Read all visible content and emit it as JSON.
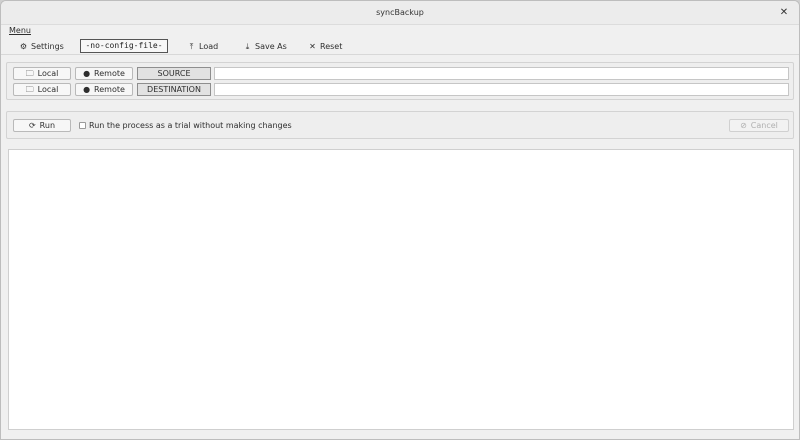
{
  "window": {
    "title": "syncBackup",
    "close_glyph": "✕"
  },
  "menubar": {
    "menu_label": "Menu"
  },
  "toolbar": {
    "settings": {
      "label": "Settings",
      "icon": "gear-icon",
      "glyph": "⚙"
    },
    "config_file": "-no-config-file-",
    "load": {
      "label": "Load",
      "icon": "upload-icon",
      "glyph": "⤒"
    },
    "save_as": {
      "label": "Save As",
      "icon": "download-icon",
      "glyph": "⤓"
    },
    "reset": {
      "label": "Reset",
      "icon": "close-icon",
      "glyph": "✕"
    }
  },
  "paths": {
    "source": {
      "local_label": "Local",
      "remote_label": "Remote",
      "tag": "SOURCE",
      "value": ""
    },
    "destination": {
      "local_label": "Local",
      "remote_label": "Remote",
      "tag": "DESTINATION",
      "value": ""
    },
    "icons": {
      "folder": "🗀",
      "globe": "●"
    }
  },
  "run": {
    "run_label": "Run",
    "run_glyph": "⟳",
    "trial_label": "Run the process as a trial without making changes",
    "trial_checked": false,
    "cancel_label": "Cancel",
    "cancel_glyph": "⊘"
  },
  "output": {
    "text": ""
  }
}
